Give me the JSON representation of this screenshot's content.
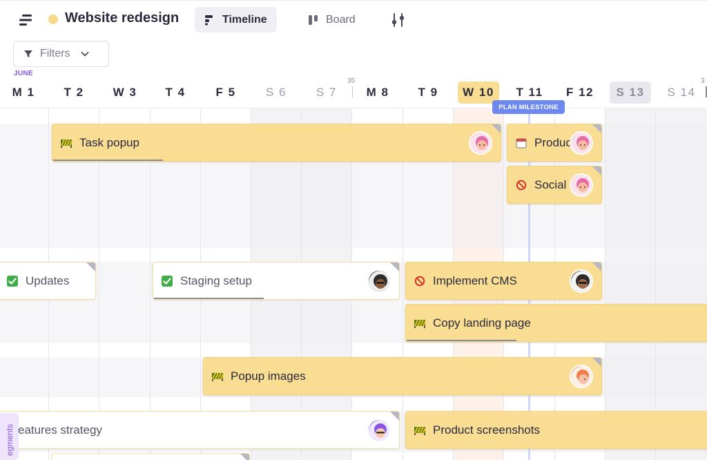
{
  "header": {
    "project_title": "Website redesign",
    "project_dot_color": "#f7d98a",
    "tabs": [
      {
        "label": "Timeline",
        "icon": "timeline-icon",
        "active": true
      },
      {
        "label": "Board",
        "icon": "board-icon",
        "active": false
      }
    ],
    "filters_label": "Filters"
  },
  "calendar": {
    "month": "JUNE",
    "days": [
      "M 1",
      "T 2",
      "W 3",
      "T 4",
      "F 5",
      "S 6",
      "S 7",
      "M 8",
      "T 9",
      "W 10",
      "T 11",
      "F 12",
      "S 13",
      "S 14"
    ],
    "week_numbers": [
      "35",
      "3"
    ],
    "today": "W 10",
    "selected": "S 13"
  },
  "milestone": {
    "label": "PLAN MILESTONE"
  },
  "tasks": [
    {
      "name": "task-popup",
      "label": "Task popup",
      "status_icon": "in-progress-icon",
      "style": "yellow"
    },
    {
      "name": "task-product",
      "label": "Produc",
      "status_icon": "calendar-icon",
      "style": "yellow"
    },
    {
      "name": "task-social",
      "label": "Social",
      "status_icon": "blocked-icon",
      "style": "yellow"
    },
    {
      "name": "task-updates",
      "label": "Updates",
      "status_icon": "done-check-icon",
      "style": "white"
    },
    {
      "name": "task-staging-setup",
      "label": "Staging setup",
      "status_icon": "done-check-icon",
      "style": "white"
    },
    {
      "name": "task-implement-cms",
      "label": "Implement CMS",
      "status_icon": "blocked-icon",
      "style": "yellow"
    },
    {
      "name": "task-copy-landing-page",
      "label": "Copy landing page",
      "status_icon": "in-progress-icon",
      "style": "yellow"
    },
    {
      "name": "task-popup-images",
      "label": "Popup images",
      "status_icon": "in-progress-icon",
      "style": "yellow"
    },
    {
      "name": "task-features-strategy",
      "label": "eatures strategy",
      "status_icon": "none",
      "style": "white"
    },
    {
      "name": "task-product-screenshots",
      "label": "Product screenshots",
      "status_icon": "in-progress-icon",
      "style": "yellow"
    }
  ],
  "sidebar": {
    "segments_label": "egments"
  }
}
